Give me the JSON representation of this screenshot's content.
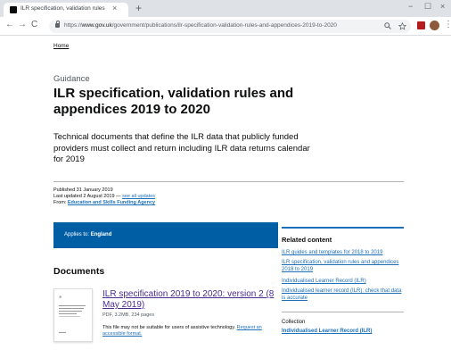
{
  "browser": {
    "tab_title": "ILR specification, validation rules",
    "tab_close": "×",
    "new_tab": "+",
    "minimize": "−",
    "maximize": "☐",
    "close": "×",
    "back": "←",
    "forward": "→",
    "reload": "C",
    "url_prefix": "https://",
    "url_domain": "www.gov.uk",
    "url_path": "/government/publications/ilr-specification-validation-rules-and-appendices-2019-to-2020",
    "zoom_icon": "magnifier-icon",
    "star_icon": "star-icon",
    "menu": "⋮"
  },
  "page": {
    "breadcrumb": "Home",
    "guidance": "Guidance",
    "title": "ILR specification, validation rules and appendices 2019 to 2020",
    "description": "Technical documents that define the ILR data that publicly funded providers must collect and return including ILR data returns calendar for 2019",
    "published": "Published 31 January 2019",
    "last_updated": "Last updated 2 August 2019 — ",
    "see_all_updates": "see all updates",
    "from_label": "From: ",
    "from_org": "Education and Skills Funding Agency",
    "applies_label": "Applies to: ",
    "applies_value": "England",
    "documents_heading": "Documents",
    "doc_title": "ILR specification 2019 to 2020: version 2 (8 May 2019)",
    "doc_meta": "PDF, 3.2MB, 234 pages",
    "doc_note": "This file may not be suitable for users of assistive technology. ",
    "doc_request": "Request an accessible format."
  },
  "related": {
    "title": "Related content",
    "links": [
      "ILR guides and templates for 2018 to 2019",
      "ILR specification, validation rules and appendices 2018 to 2019",
      "Individualised Learner Record (ILR)",
      "Individualised learner record (ILR): check that data is accurate"
    ],
    "collection_label": "Collection",
    "collection_link": "Individualised Learner Record (ILR)"
  },
  "colors": {
    "govuk_blue": "#1d70b8",
    "applies_blue": "#005ea5",
    "visited_purple": "#4c2c92",
    "text": "#0b0c0c"
  }
}
